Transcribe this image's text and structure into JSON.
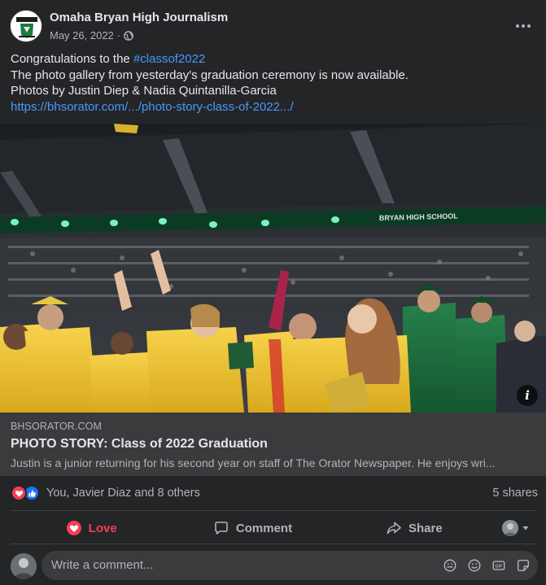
{
  "post": {
    "page_name": "Omaha Bryan High Journalism",
    "date": "May 26, 2022",
    "separator": "·",
    "caption": {
      "line1_prefix": "Congratulations to the ",
      "hashtag": "#classof2022",
      "line2": "The photo gallery from yesterday's graduation ceremony is now available.",
      "line3": "Photos by Justin Diep & Nadia Quintanilla-Garcia",
      "url": "https://bhsorator.com/.../photo-story-class-of-2022.../"
    },
    "photo": {
      "banner_text": "BRYAN HIGH SCHOOL"
    },
    "preview": {
      "domain": "BHSORATOR.COM",
      "title": "PHOTO STORY: Class of 2022 Graduation",
      "description": "Justin is a junior returning for his second year on staff of The Orator Newspaper. He enjoys wri..."
    },
    "reactions": {
      "names": "You, Javier Diaz and 8 others",
      "shares": "5 shares"
    },
    "actions": {
      "love": "Love",
      "comment": "Comment",
      "share": "Share"
    },
    "composer": {
      "placeholder": "Write a comment..."
    }
  },
  "colors": {
    "background": "#242526",
    "link": "#4599ff",
    "love": "#f33e58",
    "like": "#1877f2",
    "gown_gold": "#f1c232",
    "gown_green": "#1d6b3a"
  },
  "icons": [
    "globe-icon",
    "more-icon",
    "info-icon",
    "love-reaction-icon",
    "like-reaction-icon",
    "heart-icon",
    "comment-icon",
    "share-icon",
    "caret-down-icon",
    "sticker-icon",
    "emoji-icon",
    "gif-icon",
    "avatar-sticker-icon"
  ]
}
